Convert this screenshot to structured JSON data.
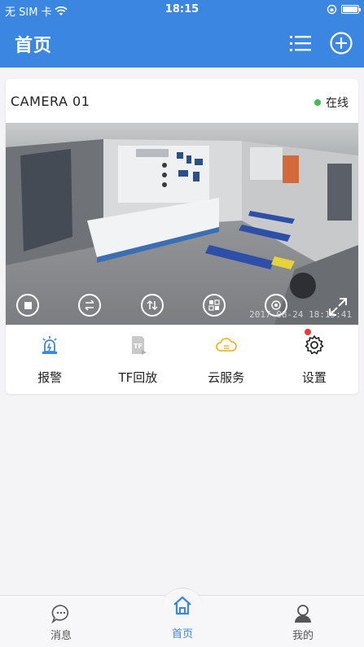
{
  "status_bar": {
    "carrier": "无 SIM 卡",
    "time": "18:15"
  },
  "header": {
    "title": "首页"
  },
  "camera": {
    "name": "CAMERA 01",
    "status": "在线",
    "timestamp": "2017-08-24 18:15:41"
  },
  "actions": [
    {
      "label": "报警"
    },
    {
      "label": "TF回放"
    },
    {
      "label": "云服务"
    },
    {
      "label": "设置"
    }
  ],
  "tabs": [
    {
      "label": "消息"
    },
    {
      "label": "首页"
    },
    {
      "label": "我的"
    }
  ],
  "colors": {
    "primary": "#3b86e0",
    "online": "#3dbd54",
    "badge": "#e53b3b"
  }
}
